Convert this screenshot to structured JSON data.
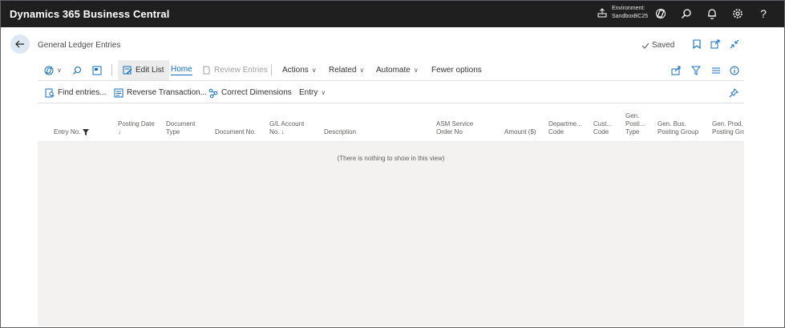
{
  "app": {
    "title": "Dynamics 365 Business Central",
    "environment_label": "Environment:",
    "environment_name": "SandboxBC25",
    "topbar_icons": [
      "copilot-icon",
      "search-icon",
      "bell-icon",
      "gear-icon",
      "help-icon"
    ]
  },
  "page": {
    "title": "General Ledger Entries",
    "saved_label": "Saved"
  },
  "actions": {
    "edit_list": "Edit List",
    "home": "Home",
    "review_entries": "Review Entries",
    "actions": "Actions",
    "related": "Related",
    "automate": "Automate",
    "fewer_options": "Fewer options"
  },
  "subactions": {
    "find_entries": "Find entries...",
    "reverse_transaction": "Reverse Transaction...",
    "correct_dimensions": "Correct Dimensions",
    "entry": "Entry"
  },
  "grid": {
    "columns": [
      {
        "l1": "",
        "l2": "",
        "l3": "Entry No."
      },
      {
        "l1": "",
        "l2": "Posting Date",
        "l3": "↓"
      },
      {
        "l1": "",
        "l2": "Document",
        "l3": "Type"
      },
      {
        "l1": "",
        "l2": "",
        "l3": "Document No."
      },
      {
        "l1": "",
        "l2": "G/L Account",
        "l3": "No. ↓"
      },
      {
        "l1": "",
        "l2": "",
        "l3": "Description"
      },
      {
        "l1": "",
        "l2": "ASM Service",
        "l3": "Order No"
      },
      {
        "l1": "",
        "l2": "",
        "l3": "Amount ($)"
      },
      {
        "l1": "",
        "l2": "Departme...",
        "l3": "Code"
      },
      {
        "l1": "",
        "l2": "Cust...",
        "l3": "Code"
      },
      {
        "l1": "Gen.",
        "l2": "Posti...",
        "l3": "Type"
      },
      {
        "l1": "",
        "l2": "Gen. Bus.",
        "l3": "Posting Group"
      },
      {
        "l1": "",
        "l2": "Gen. Prod.",
        "l3": "Posting Grc"
      }
    ],
    "empty_message": "(There is nothing to show in this view)"
  },
  "colors": {
    "topbar_bg": "#1f1f1f",
    "accent": "#0f6cbd",
    "grid_bg": "#f3f2f1"
  }
}
